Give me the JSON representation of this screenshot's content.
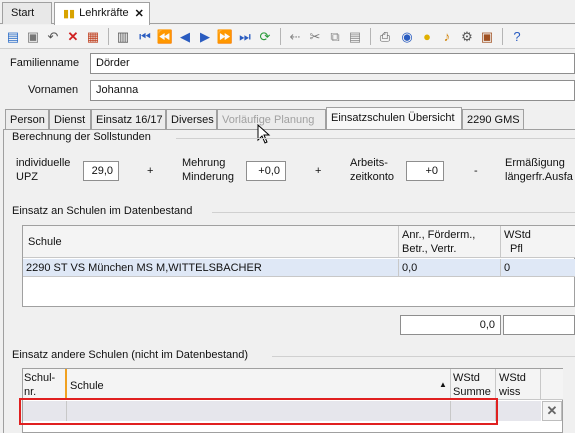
{
  "window_tabs": [
    {
      "label": "Start"
    },
    {
      "label": "Lehrkräfte"
    }
  ],
  "form": {
    "familienname_label": "Familienname",
    "familienname_value": "Dörder",
    "vornamen_label": "Vornamen",
    "vornamen_value": "Johanna"
  },
  "section_tabs": [
    {
      "label": "Person"
    },
    {
      "label": "Dienst"
    },
    {
      "label": "Einsatz 16/17"
    },
    {
      "label": "Diverses"
    },
    {
      "label": "Vorläufige Planung"
    },
    {
      "label": "Einsatzschulen Übersicht"
    },
    {
      "label": "2290 GMS"
    }
  ],
  "soll": {
    "title": "Berechnung der Sollstunden",
    "upz_label_1": "individuelle",
    "upz_label_2": "UPZ",
    "upz_value": "29,0",
    "plus1": "+",
    "mehrung_label_1": "Mehrung",
    "mehrung_label_2": "Minderung",
    "mehrung_value": "+0,0",
    "plus2": "+",
    "arbeit_label_1": "Arbeits-",
    "arbeit_label_2": "zeitkonto",
    "arbeit_value": "+0",
    "minus": "-",
    "erm_label_1": "Ermäßigung",
    "erm_label_2": "längerfr.Ausfa"
  },
  "einsatz_db": {
    "title": "Einsatz an Schulen im Datenbestand",
    "col_schule": "Schule",
    "col_anr_1": "Anr., Förderm.,",
    "col_anr_2": "Betr., Vertr.",
    "col_wstd_1": "WStd",
    "col_wstd_2": "Pfl",
    "rows": [
      {
        "schule": "2290 ST VS München MS M,WITTELSBACHER",
        "anr": "0,0",
        "wstd": "0"
      }
    ],
    "sum_value": "0,0"
  },
  "einsatz_andere": {
    "title": "Einsatz andere Schulen (nicht im Datenbestand)",
    "col_schulnr_1": "Schul-",
    "col_schulnr_2": "nr.",
    "col_schule": "Schule",
    "col_summe_1": "WStd",
    "col_summe_2": "Summe",
    "col_wiss_1": "WStd",
    "col_wiss_2": "wiss",
    "delete_glyph": "✕"
  },
  "colors": {
    "highlight_red": "#e02020",
    "accent_blue": "#1f5fbf",
    "selected_row": "#dfe8f6"
  }
}
